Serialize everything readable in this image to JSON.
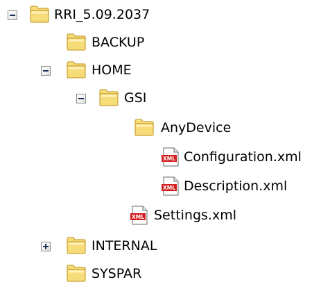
{
  "tree": {
    "root": {
      "label": "RRI_5.09.2037",
      "expander": "minus",
      "icon": "folder-open-icon"
    },
    "backup": {
      "label": "BACKUP",
      "icon": "folder-icon"
    },
    "home": {
      "label": "HOME",
      "expander": "minus",
      "icon": "folder-icon"
    },
    "gsi": {
      "label": "GSI",
      "expander": "minus",
      "icon": "folder-icon"
    },
    "anydevice": {
      "label": "AnyDevice",
      "icon": "folder-icon"
    },
    "configuration": {
      "label": "Configuration.xml",
      "icon": "xml-file-icon",
      "icon_text": "XML"
    },
    "description": {
      "label": "Description.xml",
      "icon": "xml-file-icon",
      "icon_text": "XML"
    },
    "settings": {
      "label": "Settings.xml",
      "icon": "xml-file-icon",
      "icon_text": "XML"
    },
    "internal": {
      "label": "INTERNAL",
      "expander": "plus",
      "icon": "folder-icon"
    },
    "syspar": {
      "label": "SYSPAR",
      "icon": "folder-icon"
    }
  },
  "colors": {
    "folder_body": "#f7dc7a",
    "folder_light": "#fff1b8",
    "folder_edge": "#c9a236",
    "xml_red": "#d41d1d",
    "expander_border": "#8c8c8c",
    "expander_glyph": "#1c2e5a"
  }
}
